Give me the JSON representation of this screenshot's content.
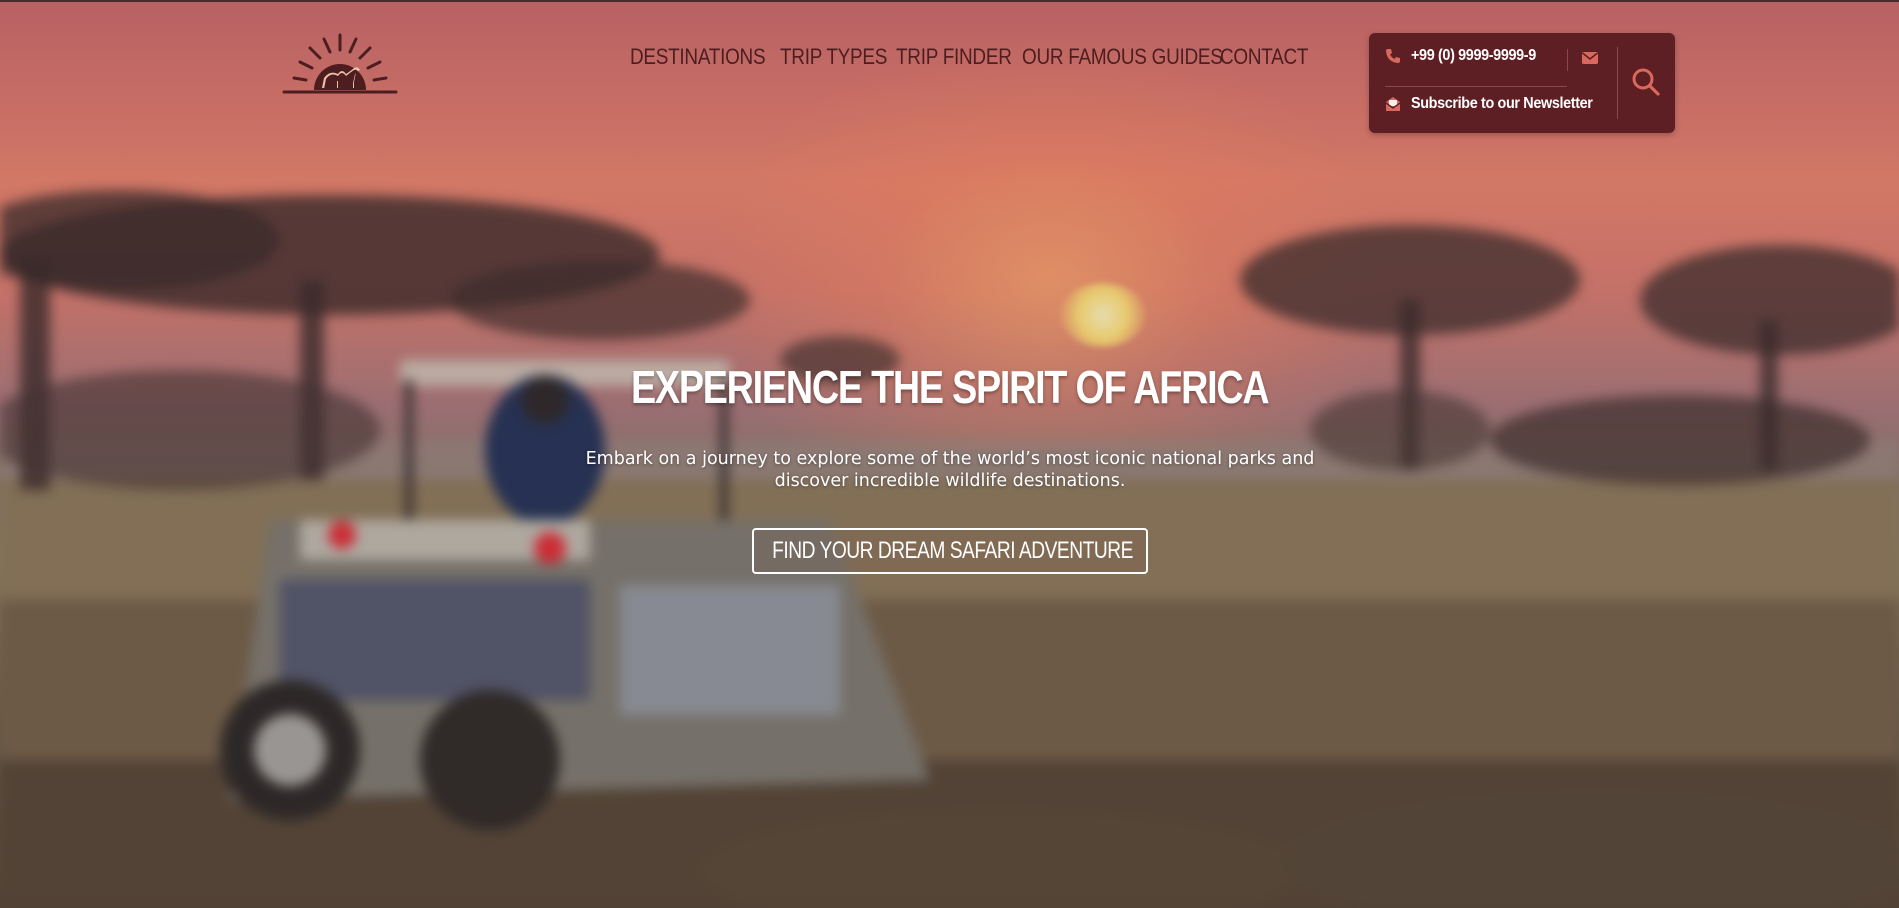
{
  "brand": {
    "logo_icon": "sunrise-camel-logo-icon"
  },
  "nav": {
    "items": [
      {
        "label": "DESTINATIONS"
      },
      {
        "label": "TRIP TYPES"
      },
      {
        "label": "TRIP FINDER"
      },
      {
        "label": "OUR FAMOUS GUIDES"
      },
      {
        "label": "CONTACT"
      }
    ]
  },
  "contact": {
    "phone": "+99 (0) 9999-9999-9",
    "phone_icon": "phone-icon",
    "email_icon": "envelope-icon",
    "newsletter_label": "Subscribe to our Newsletter",
    "newsletter_icon": "newsletter-envelope-icon",
    "search_icon": "search-icon"
  },
  "hero": {
    "headline": "EXPERIENCE THE SPIRIT OF AFRICA",
    "subtext": "Embark on a journey to explore some of the world’s most iconic national parks and discover incredible wildlife destinations.",
    "cta_label": "FIND YOUR DREAM SAFARI ADVENTURE",
    "cta_icon": "chevron-right-icon"
  },
  "colors": {
    "brand_dark": "#5d1f23",
    "nav_text": "#4d1d20",
    "accent_icon": "#d9695c",
    "white": "#ffffff"
  }
}
